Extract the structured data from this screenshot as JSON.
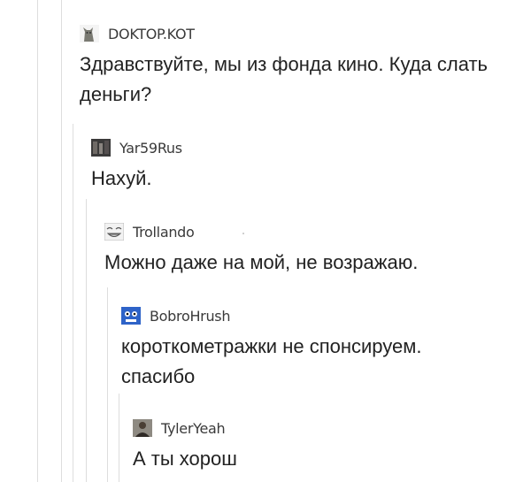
{
  "thread": [
    {
      "username": "DOKTOP.KOT",
      "avatar_icon": "cat-icon",
      "lines": [
        "Здравствуйте, мы из фонда кино. Куда слать",
        "деньги?"
      ]
    },
    {
      "username": "Yar59Rus",
      "avatar_icon": "photo-avatar-icon",
      "lines": [
        "Нахуй."
      ]
    },
    {
      "username": "Trollando",
      "avatar_icon": "meme-face-icon",
      "lines": [
        "Можно даже на мой, не возражаю."
      ]
    },
    {
      "username": "BobroHrush",
      "avatar_icon": "blue-face-icon",
      "lines": [
        "короткометражки не спонсируем.",
        "спасибо"
      ]
    },
    {
      "username": "TylerYeah",
      "avatar_icon": "person-photo-icon",
      "lines": [
        "А ты хорош"
      ]
    }
  ]
}
